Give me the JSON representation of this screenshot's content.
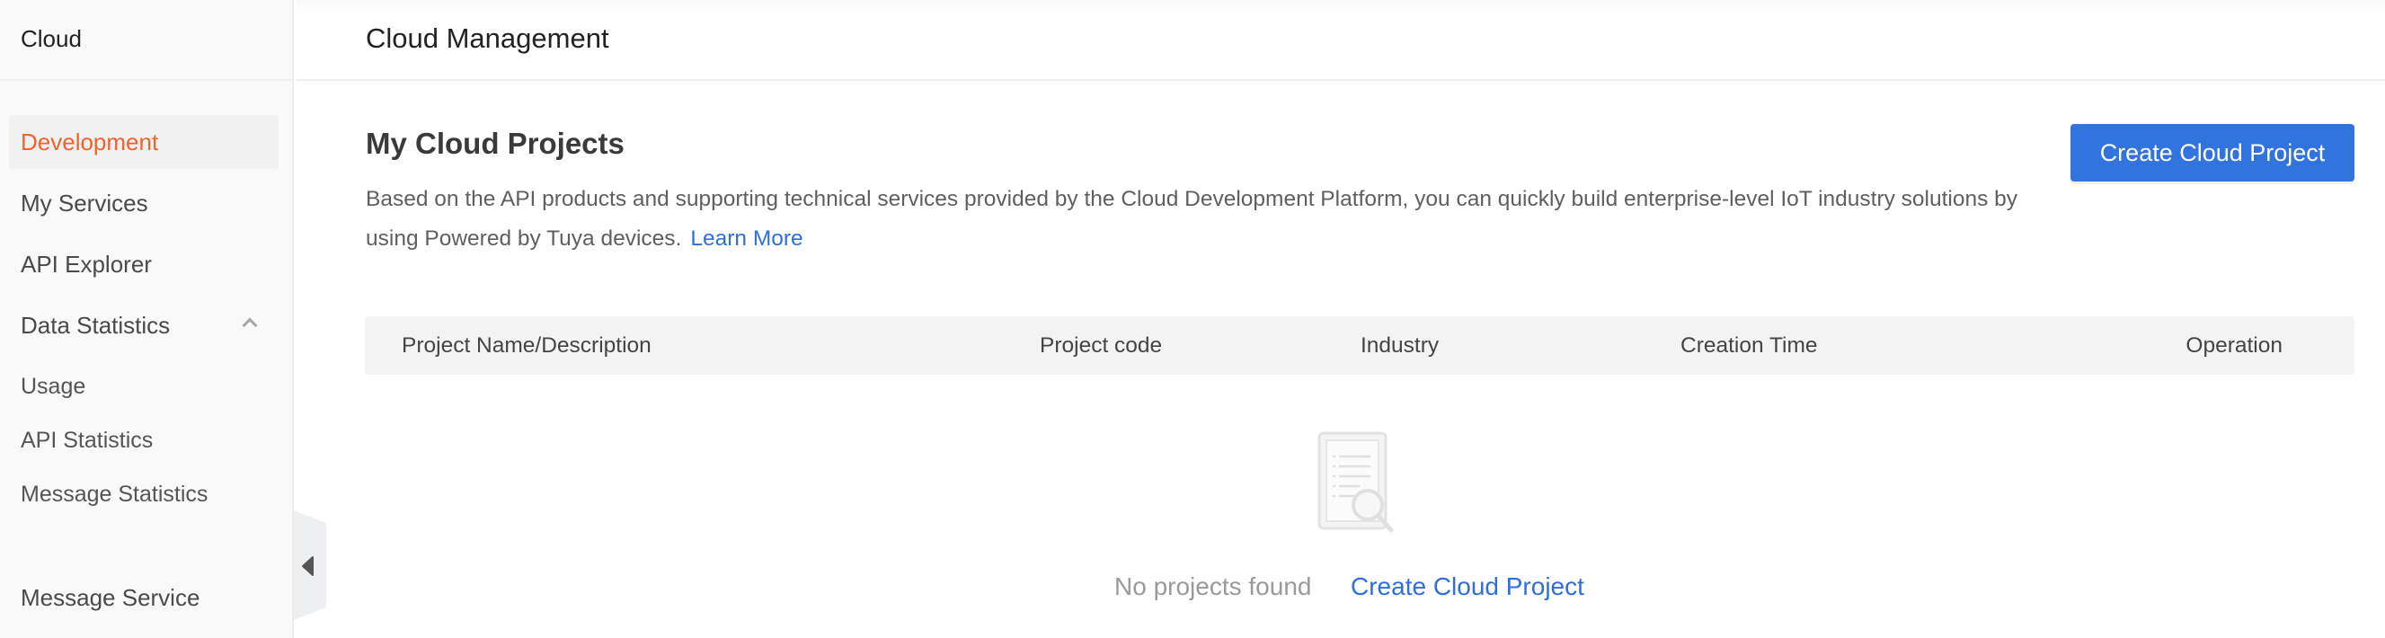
{
  "sidebar": {
    "title": "Cloud",
    "items": [
      {
        "label": "Development",
        "active": true
      },
      {
        "label": "My Services"
      },
      {
        "label": "API Explorer"
      },
      {
        "label": "Data Statistics",
        "expanded": true,
        "icon": "chevron-up-icon"
      },
      {
        "label": "Usage"
      },
      {
        "label": "API Statistics"
      },
      {
        "label": "Message Statistics"
      },
      {
        "label": "Message Service"
      }
    ],
    "collapse_icon": "caret-left-icon"
  },
  "header": {
    "title": "Cloud Management"
  },
  "main": {
    "section_title": "My Cloud Projects",
    "description": "Based on the API products and supporting technical services provided by the Cloud Development Platform, you can quickly build enterprise-level IoT industry solutions by using Powered by Tuya devices.",
    "learn_more": "Learn More",
    "create_button": "Create Cloud Project",
    "table": {
      "columns": [
        "Project Name/Description",
        "Project code",
        "Industry",
        "Creation Time",
        "Operation"
      ],
      "rows": []
    },
    "empty_state": {
      "icon": "document-search-icon",
      "message": "No projects found",
      "action": "Create Cloud Project"
    }
  },
  "colors": {
    "accent": "#3174dd",
    "link": "#2f6fdc",
    "active_nav": "#f0622e",
    "sidebar_bg": "#f9f9f9",
    "table_header_bg": "#f3f3f3"
  }
}
